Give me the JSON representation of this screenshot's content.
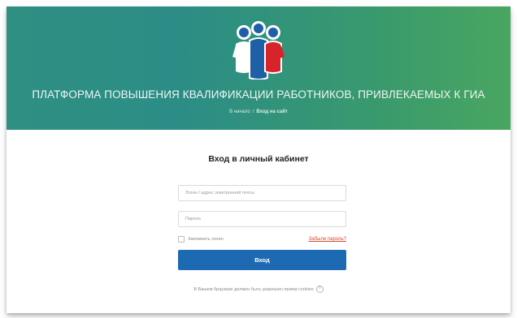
{
  "header": {
    "title": "ПЛАТФОРМА ПОВЫШЕНИЯ КВАЛИФИКАЦИИ РАБОТНИКОВ, ПРИВЛЕКАЕМЫХ К ГИА",
    "breadcrumb": {
      "home": "В начало",
      "separator": "/",
      "current": "Вход на сайт"
    },
    "logo_icon": "people-figures-logo-icon",
    "colors": {
      "banner_start": "#2f8f83",
      "banner_end": "#49a660"
    }
  },
  "login_form": {
    "title": "Вход в личный кабинет",
    "login_placeholder": "Логин / адрес электронной почты",
    "login_value": "",
    "password_placeholder": "Пароль",
    "password_value": "",
    "remember_label": "Запомнить логин",
    "remember_checked": false,
    "forgot_link": "Забыли пароль?",
    "submit_label": "Вход",
    "cookie_note": "В Вашем браузере должен быть разрешен прием cookies",
    "help_icon": "question-circle-icon",
    "colors": {
      "submit": "#1e6ab2",
      "forgot": "#d9482f"
    }
  }
}
